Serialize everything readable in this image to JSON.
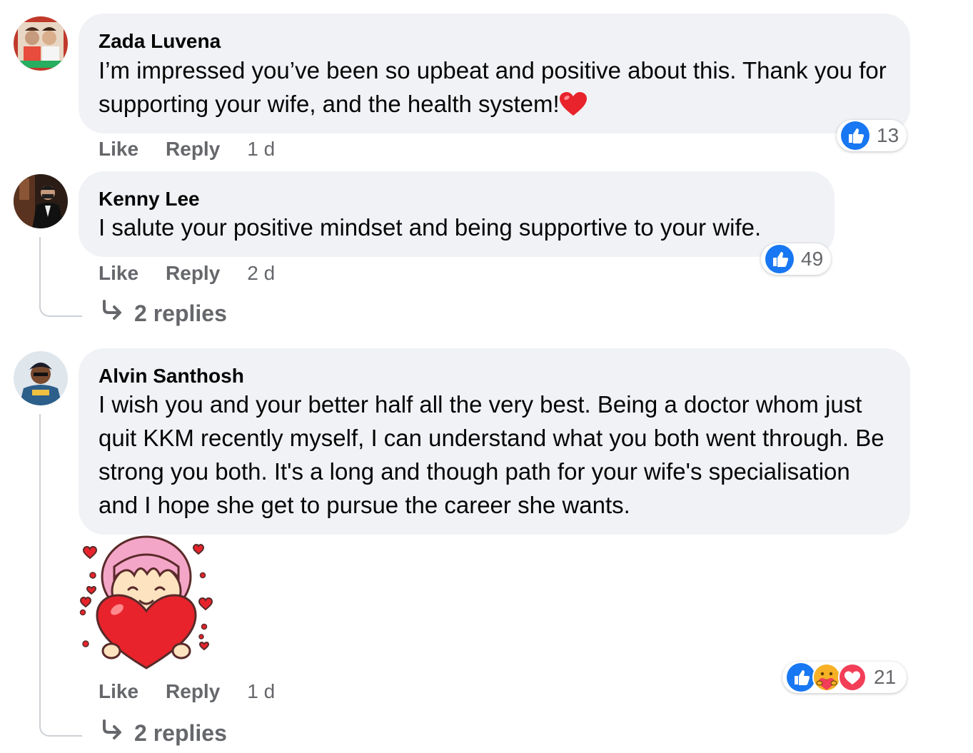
{
  "comments": [
    {
      "author": "Zada Luvena",
      "text": "I’m impressed you’ve been so upbeat and positive about this. Thank you for supporting your wife, and the health system!",
      "emoji": "red-heart",
      "actions": {
        "like": "Like",
        "reply": "Reply",
        "time": "1 d"
      },
      "reactions": {
        "icons": [
          "like-icon"
        ],
        "count": "13"
      }
    },
    {
      "author": "Kenny Lee",
      "text": "I salute your positive mindset and being supportive to your wife.",
      "actions": {
        "like": "Like",
        "reply": "Reply",
        "time": "2 d"
      },
      "reactions": {
        "icons": [
          "like-icon"
        ],
        "count": "49"
      },
      "replies": "2 replies"
    },
    {
      "author": "Alvin Santhosh",
      "text": "I wish you and your better half all the very best. Being a doctor whom just quit KKM recently myself, I can understand what you both went through. Be strong you both. It's a long and though path for your wife's specialisation and I hope she get to pursue the career she wants.",
      "sticker": "girl-holding-heart-sticker",
      "actions": {
        "like": "Like",
        "reply": "Reply",
        "time": "1 d"
      },
      "reactions": {
        "icons": [
          "like-icon",
          "care-icon",
          "love-icon"
        ],
        "count": "21"
      },
      "replies": "2 replies"
    }
  ],
  "colors": {
    "bubble": "#f0f2f5",
    "secondary_text": "#65676b",
    "like_blue": "#1877f2",
    "love_red": "#f33e58",
    "care_yellow": "#f7b125"
  }
}
